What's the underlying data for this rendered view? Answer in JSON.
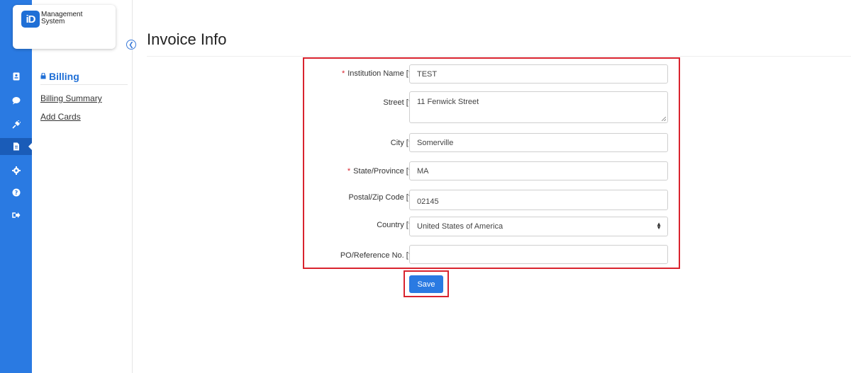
{
  "app": {
    "logo_mark": "iD",
    "logo_line1": "Management",
    "logo_line2": "System"
  },
  "rail": {
    "icons": [
      "id-card-icon",
      "chat-icon",
      "plug-icon",
      "invoice-icon",
      "gear-icon",
      "help-icon",
      "sign-out-icon"
    ],
    "active_index": 3
  },
  "submenu": {
    "title": "Billing",
    "items": [
      "Billing Summary",
      "Add Cards"
    ]
  },
  "page": {
    "title": "Invoice Info"
  },
  "form": {
    "institution_name": {
      "label": "Institution Name [?]",
      "required": true,
      "value": "TEST"
    },
    "street": {
      "label": "Street [?]",
      "required": false,
      "value": "11 Fenwick Street"
    },
    "city": {
      "label": "City [?]",
      "required": false,
      "value": "Somerville"
    },
    "state": {
      "label": "State/Province [?]",
      "required": true,
      "value": "MA"
    },
    "postal": {
      "label": "Postal/Zip Code [?]",
      "required": false,
      "value": "02145"
    },
    "country": {
      "label": "Country [?]",
      "required": false,
      "value": "United States of America"
    },
    "po_ref": {
      "label": "PO/Reference No. [?]",
      "required": false,
      "value": ""
    },
    "required_marker": "*"
  },
  "actions": {
    "save_label": "Save"
  },
  "colors": {
    "primary": "#2a7ae2",
    "highlight_border": "#d9232e"
  }
}
